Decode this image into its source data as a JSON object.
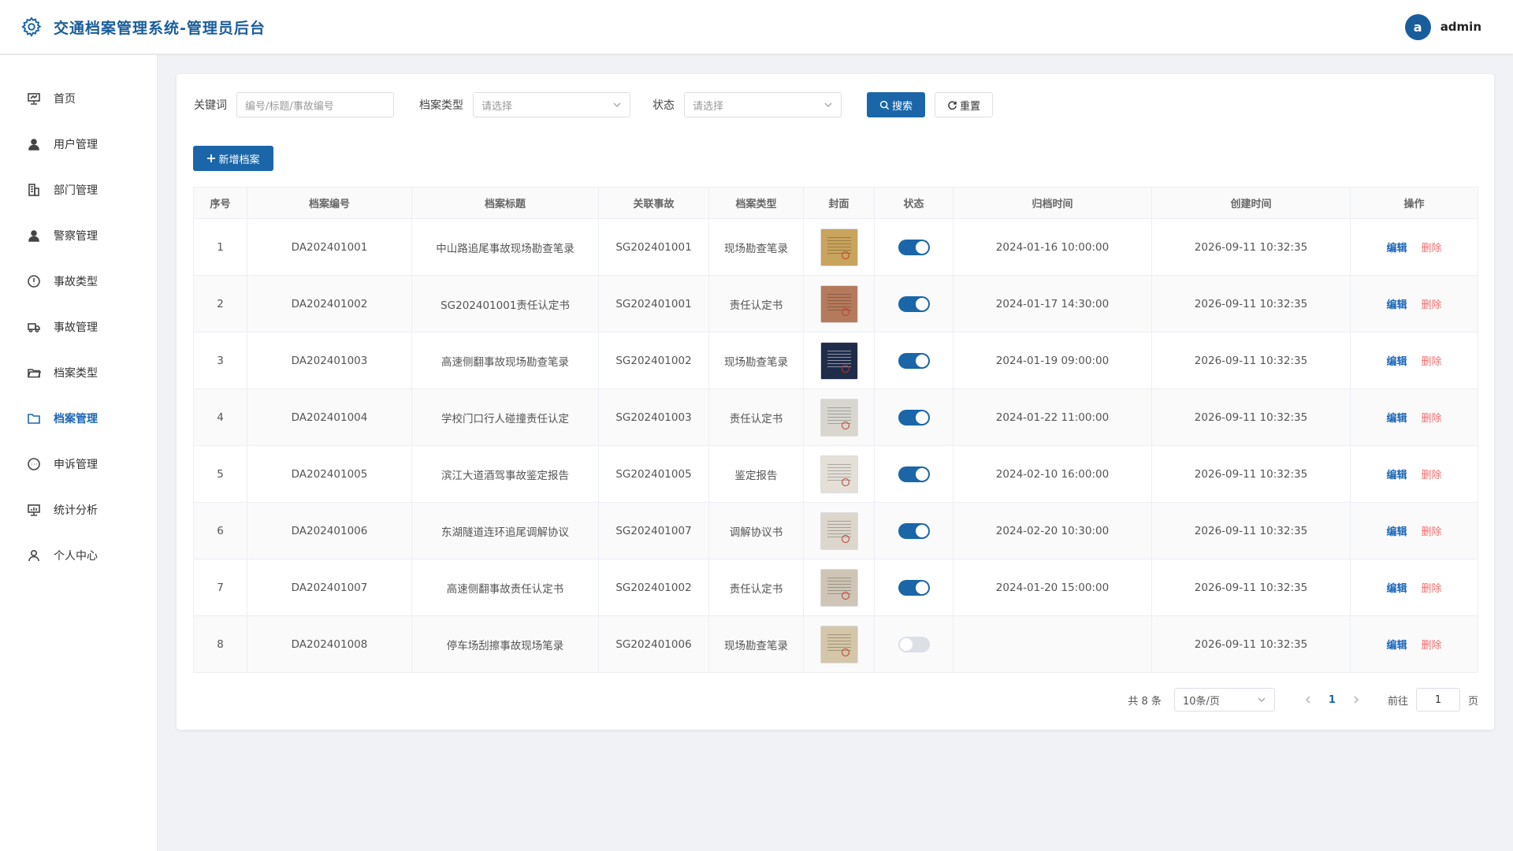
{
  "header": {
    "title": "交通档案管理系统-管理员后台",
    "avatar_letter": "a",
    "user": "admin"
  },
  "sidebar": {
    "items": [
      {
        "label": "首页",
        "icon": "dashboard-icon"
      },
      {
        "label": "用户管理",
        "icon": "user-icon"
      },
      {
        "label": "部门管理",
        "icon": "building-icon"
      },
      {
        "label": "警察管理",
        "icon": "police-icon"
      },
      {
        "label": "事故类型",
        "icon": "alert-icon"
      },
      {
        "label": "事故管理",
        "icon": "truck-icon"
      },
      {
        "label": "档案类型",
        "icon": "folder-open-icon"
      },
      {
        "label": "档案管理",
        "icon": "folder-icon",
        "active": true
      },
      {
        "label": "申诉管理",
        "icon": "chat-icon"
      },
      {
        "label": "统计分析",
        "icon": "chart-icon"
      },
      {
        "label": "个人中心",
        "icon": "profile-icon"
      }
    ]
  },
  "filters": {
    "keyword_label": "关键词",
    "keyword_placeholder": "编号/标题/事故编号",
    "type_label": "档案类型",
    "type_placeholder": "请选择",
    "status_label": "状态",
    "status_placeholder": "请选择",
    "search_label": "搜索",
    "reset_label": "重置"
  },
  "add_button": "新增档案",
  "table": {
    "columns": [
      "序号",
      "档案编号",
      "档案标题",
      "关联事故",
      "档案类型",
      "封面",
      "状态",
      "归档时间",
      "创建时间",
      "操作"
    ],
    "edit_label": "编辑",
    "delete_label": "删除",
    "rows": [
      {
        "no": "1",
        "code": "DA202401001",
        "title": "中山路追尾事故现场勘查笔录",
        "accident": "SG202401001",
        "type": "现场勘查笔录",
        "status": true,
        "archived": "2024-01-16 10:00:00",
        "created": "2026-09-11 10:32:35",
        "cover_color": "#c9a45c"
      },
      {
        "no": "2",
        "code": "DA202401002",
        "title": "SG202401001责任认定书",
        "accident": "SG202401001",
        "type": "责任认定书",
        "status": true,
        "archived": "2024-01-17 14:30:00",
        "created": "2026-09-11 10:32:35",
        "cover_color": "#b57a5c"
      },
      {
        "no": "3",
        "code": "DA202401003",
        "title": "高速侧翻事故现场勘查笔录",
        "accident": "SG202401002",
        "type": "现场勘查笔录",
        "status": true,
        "archived": "2024-01-19 09:00:00",
        "created": "2026-09-11 10:32:35",
        "cover_color": "#1f2c4a"
      },
      {
        "no": "4",
        "code": "DA202401004",
        "title": "学校门口行人碰撞责任认定",
        "accident": "SG202401003",
        "type": "责任认定书",
        "status": true,
        "archived": "2024-01-22 11:00:00",
        "created": "2026-09-11 10:32:35",
        "cover_color": "#d8d6cf"
      },
      {
        "no": "5",
        "code": "DA202401005",
        "title": "滨江大道酒驾事故鉴定报告",
        "accident": "SG202401005",
        "type": "鉴定报告",
        "status": true,
        "archived": "2024-02-10 16:00:00",
        "created": "2026-09-11 10:32:35",
        "cover_color": "#e4e0d8"
      },
      {
        "no": "6",
        "code": "DA202401006",
        "title": "东湖隧道连环追尾调解协议",
        "accident": "SG202401007",
        "type": "调解协议书",
        "status": true,
        "archived": "2024-02-20 10:30:00",
        "created": "2026-09-11 10:32:35",
        "cover_color": "#dcd6cc"
      },
      {
        "no": "7",
        "code": "DA202401007",
        "title": "高速侧翻事故责任认定书",
        "accident": "SG202401002",
        "type": "责任认定书",
        "status": true,
        "archived": "2024-01-20 15:00:00",
        "created": "2026-09-11 10:32:35",
        "cover_color": "#cfc5b6"
      },
      {
        "no": "8",
        "code": "DA202401008",
        "title": "停车场刮擦事故现场笔录",
        "accident": "SG202401006",
        "type": "现场勘查笔录",
        "status": false,
        "archived": "",
        "created": "2026-09-11 10:32:35",
        "cover_color": "#d4c6a8"
      }
    ]
  },
  "pagination": {
    "total": "共 8 条",
    "page_size": "10条/页",
    "current": "1",
    "goto_label": "前往",
    "goto_value": "1",
    "page_suffix": "页"
  },
  "colors": {
    "primary": "#1a66a8",
    "danger": "#f56c6c"
  }
}
